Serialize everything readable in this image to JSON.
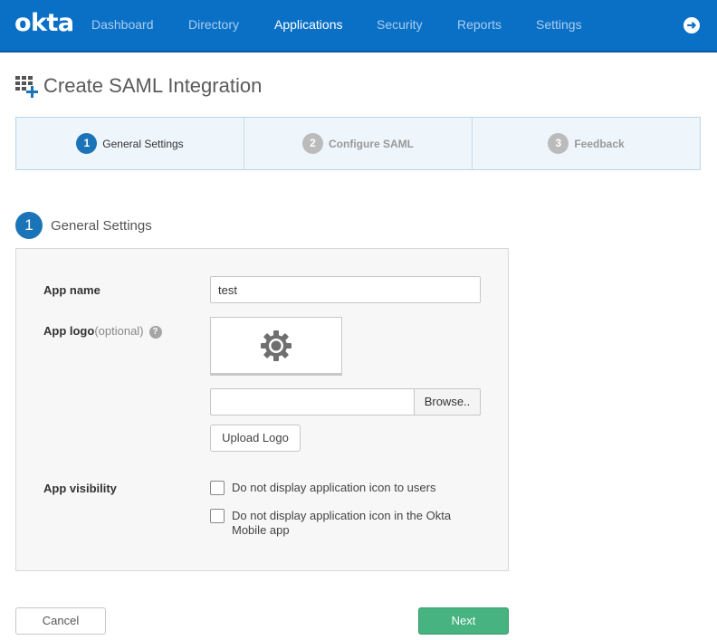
{
  "app": {
    "logo_text": "okta"
  },
  "nav": {
    "items": [
      {
        "label": "Dashboard"
      },
      {
        "label": "Directory"
      },
      {
        "label": "Applications"
      },
      {
        "label": "Security"
      },
      {
        "label": "Reports"
      },
      {
        "label": "Settings"
      }
    ],
    "active": "Applications",
    "signout_icon": "arrow-right-circle-icon"
  },
  "page": {
    "title": "Create SAML Integration",
    "icon": "grid-add-icon"
  },
  "wizard": {
    "steps": [
      {
        "num": "1",
        "label": "General Settings",
        "active": true
      },
      {
        "num": "2",
        "label": "Configure SAML",
        "active": false
      },
      {
        "num": "3",
        "label": "Feedback",
        "active": false
      }
    ]
  },
  "section": {
    "num": "1",
    "title": "General Settings"
  },
  "form": {
    "app_name_label": "App name",
    "app_name_value": "test",
    "app_logo_label": "App logo",
    "app_logo_optional": "(optional)",
    "help_glyph": "?",
    "logo_placeholder_icon": "gear-icon",
    "browse_label": "Browse..",
    "upload_label": "Upload Logo",
    "visibility_label": "App visibility",
    "checkbox_1_label": "Do not display application icon to users",
    "checkbox_2_label_line1": "Do not display application icon in the Okta",
    "checkbox_2_label_line2": "Mobile app"
  },
  "actions": {
    "cancel_label": "Cancel",
    "next_label": "Next"
  },
  "colors": {
    "nav_bg": "#0a70c6",
    "accent": "#1a74b7",
    "next_btn": "#46b380",
    "steps_bg": "#eef5fb"
  }
}
